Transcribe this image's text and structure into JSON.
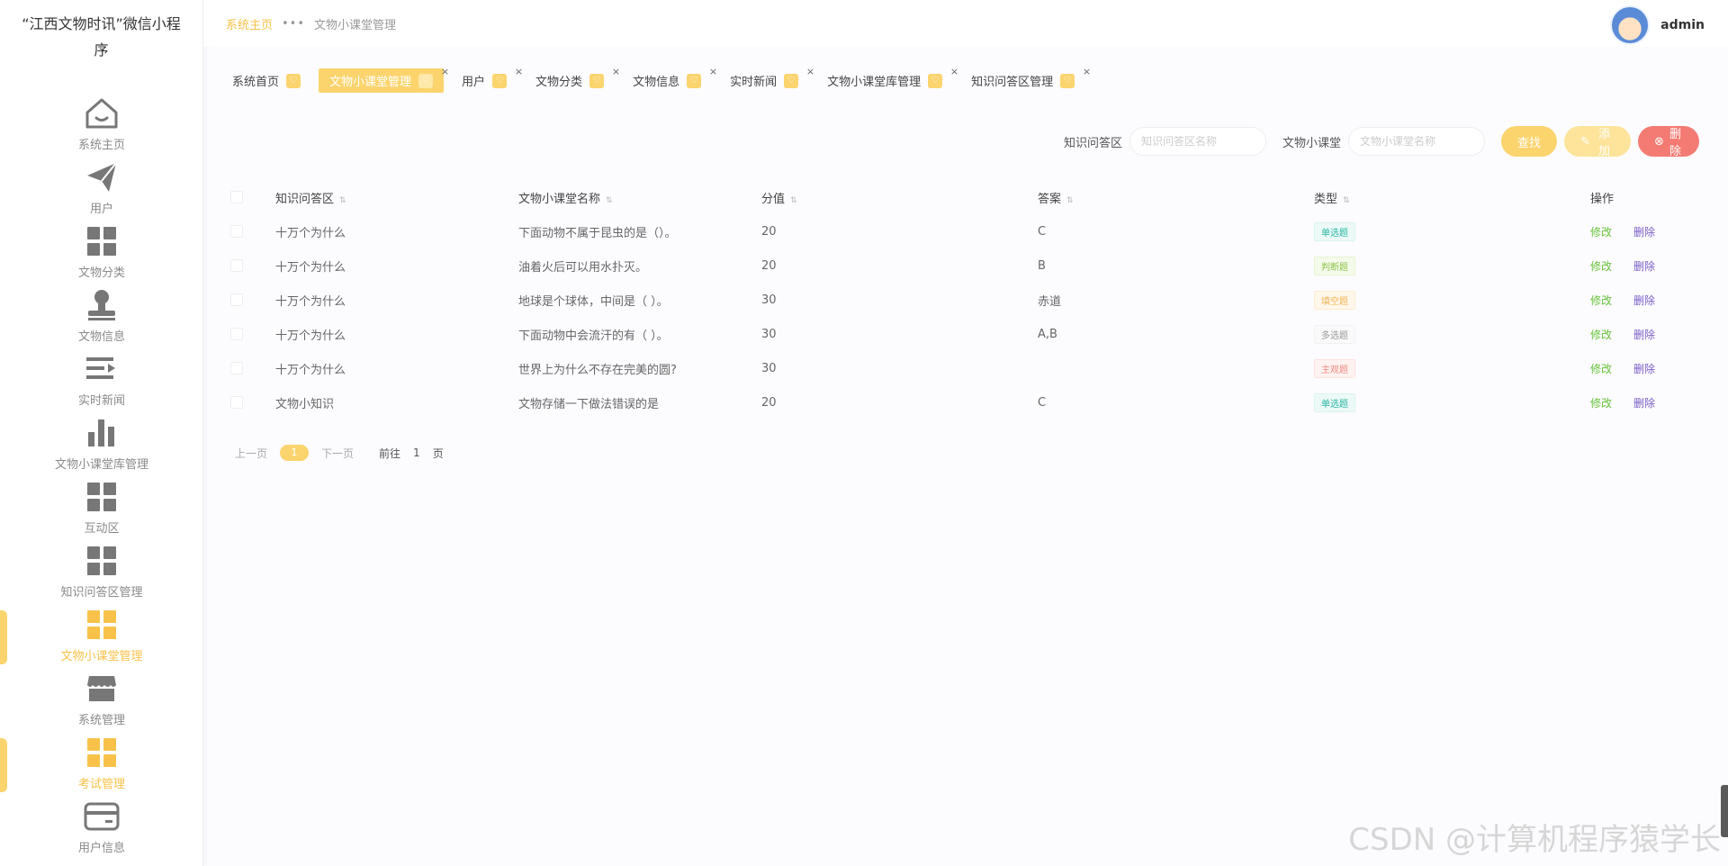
{
  "app": {
    "title": "“江西文物时讯”微信小程序"
  },
  "sidebar": {
    "items": [
      {
        "label": "系统主页",
        "icon": "home-icon",
        "active": false
      },
      {
        "label": "用户",
        "icon": "paper-plane-icon",
        "active": false
      },
      {
        "label": "文物分类",
        "icon": "grid-icon",
        "active": false
      },
      {
        "label": "文物信息",
        "icon": "stamp-icon",
        "active": false
      },
      {
        "label": "实时新闻",
        "icon": "list-icon",
        "active": false
      },
      {
        "label": "文物小课堂库管理",
        "icon": "bar-chart-icon",
        "active": false
      },
      {
        "label": "互动区",
        "icon": "grid-icon",
        "active": false
      },
      {
        "label": "知识问答区管理",
        "icon": "grid-icon",
        "active": false
      },
      {
        "label": "文物小课堂管理",
        "icon": "grid-icon",
        "active": true
      },
      {
        "label": "系统管理",
        "icon": "store-icon",
        "active": false
      },
      {
        "label": "考试管理",
        "icon": "grid-icon",
        "active": true
      },
      {
        "label": "用户信息",
        "icon": "card-icon",
        "active": false
      }
    ]
  },
  "header": {
    "breadcrumb_home": "系统主页",
    "breadcrumb_sep": "•••",
    "breadcrumb_current": "文物小课堂管理",
    "username": "admin"
  },
  "tabs": [
    {
      "label": "系统首页",
      "active": false,
      "closable": false
    },
    {
      "label": "文物小课堂管理",
      "active": true,
      "closable": true
    },
    {
      "label": "用户",
      "active": false,
      "closable": true
    },
    {
      "label": "文物分类",
      "active": false,
      "closable": true
    },
    {
      "label": "文物信息",
      "active": false,
      "closable": true
    },
    {
      "label": "实时新闻",
      "active": false,
      "closable": true
    },
    {
      "label": "文物小课堂库管理",
      "active": false,
      "closable": true
    },
    {
      "label": "知识问答区管理",
      "active": false,
      "closable": true
    }
  ],
  "search": {
    "label1": "知识问答区",
    "placeholder1": "知识问答区名称",
    "label2": "文物小课堂",
    "placeholder2": "文物小课堂名称",
    "find": "查找",
    "add": "添加",
    "delete": "删除"
  },
  "table": {
    "headers": [
      "知识问答区",
      "文物小课堂名称",
      "分值",
      "答案",
      "类型",
      "操作"
    ],
    "rows": [
      {
        "zone": "十万个为什么",
        "name": "下面动物不属于昆虫的是（）。",
        "score": "20",
        "answer": "C",
        "type": "单选题",
        "type_class": "tag-danxuan"
      },
      {
        "zone": "十万个为什么",
        "name": "油着火后可以用水扑灭。",
        "score": "20",
        "answer": "B",
        "type": "判断题",
        "type_class": "tag-panduan"
      },
      {
        "zone": "十万个为什么",
        "name": "地球是个球体，中间是（ ）。",
        "score": "30",
        "answer": "赤道",
        "type": "填空题",
        "type_class": "tag-tiankong"
      },
      {
        "zone": "十万个为什么",
        "name": "下面动物中会流汗的有（ ）。",
        "score": "30",
        "answer": "A,B",
        "type": "多选题",
        "type_class": "tag-duoxuan"
      },
      {
        "zone": "十万个为什么",
        "name": "世界上为什么不存在完美的圆?",
        "score": "30",
        "answer": "",
        "type": "主观题",
        "type_class": "tag-zhuguan"
      },
      {
        "zone": "文物小知识",
        "name": "文物存储一下做法错误的是",
        "score": "20",
        "answer": "C",
        "type": "单选题",
        "type_class": "tag-danxuan"
      }
    ],
    "op_edit": "修改",
    "op_delete": "删除"
  },
  "pager": {
    "prev": "上一页",
    "current": "1",
    "next": "下一页",
    "goto_label": "前往",
    "goto_value": "1",
    "page_suffix": "页"
  },
  "watermark": "CSDN @计算机程序猿学长",
  "colors": {
    "accent": "#fbd46e",
    "danger": "#f47b73",
    "edit": "#67c23a",
    "delete": "#7b5ec6"
  }
}
